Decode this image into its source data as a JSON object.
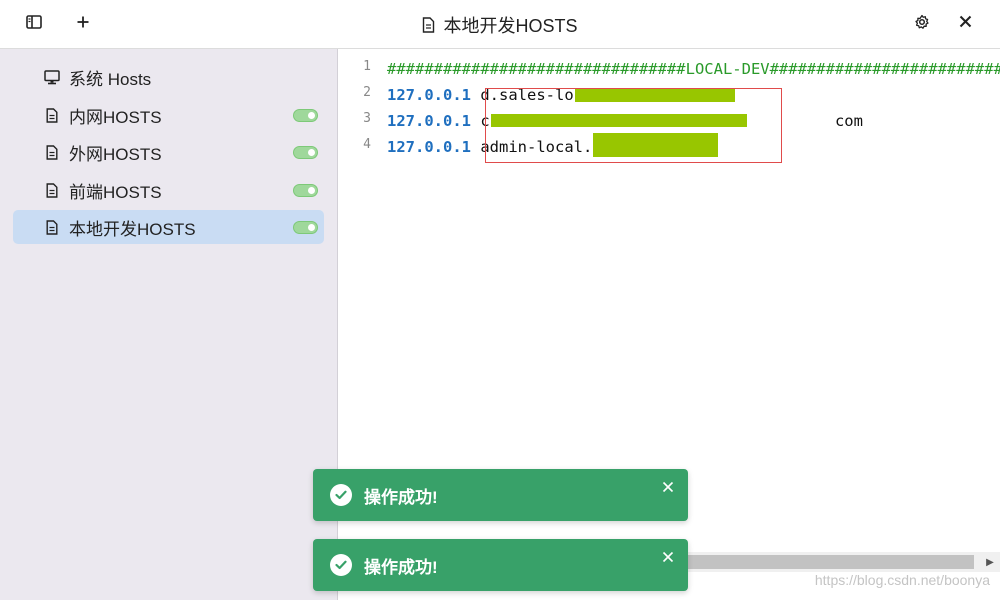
{
  "titlebar": {
    "title": "本地开发HOSTS",
    "icons": {
      "sidebar_toggle": "sidebar-icon",
      "add": "plus-icon",
      "title_doc": "document-icon",
      "settings": "gear-icon",
      "close": "close-icon"
    }
  },
  "sidebar": {
    "items": [
      {
        "label": "系统 Hosts",
        "icon": "monitor-icon",
        "enabled": null,
        "active": false
      },
      {
        "label": "内网HOSTS",
        "icon": "document-icon",
        "enabled": true,
        "active": false
      },
      {
        "label": "外网HOSTS",
        "icon": "document-icon",
        "enabled": true,
        "active": false
      },
      {
        "label": "前端HOSTS",
        "icon": "document-icon",
        "enabled": true,
        "active": false
      },
      {
        "label": "本地开发HOSTS",
        "icon": "document-icon",
        "enabled": true,
        "active": true
      }
    ]
  },
  "editor": {
    "lines": [
      {
        "num": "1",
        "ip": "",
        "host": "",
        "comment": "################################LOCAL-DEV###############################"
      },
      {
        "num": "2",
        "ip": "127.0.0.1",
        "host": "d.sales-lo",
        "comment": ""
      },
      {
        "num": "3",
        "ip": "127.0.0.1",
        "host": "c                                     com",
        "comment": ""
      },
      {
        "num": "4",
        "ip": "127.0.0.1",
        "host": "admin-local.",
        "comment": ""
      }
    ]
  },
  "toasts": [
    {
      "message": "操作成功!",
      "icon": "check-circle-icon"
    },
    {
      "message": "操作成功!",
      "icon": "check-circle-icon"
    }
  ],
  "watermark": "https://blog.csdn.net/boonya",
  "colors": {
    "toast_bg": "#38a169",
    "active_item_bg": "#c9dcf3",
    "sidebar_bg": "#ebe8ef",
    "toggle_on": "#9fd89b",
    "comment": "#2a9a2a",
    "ip": "#1f6fbf",
    "redaction": "#98c600",
    "selection_border": "#e04b4b"
  }
}
